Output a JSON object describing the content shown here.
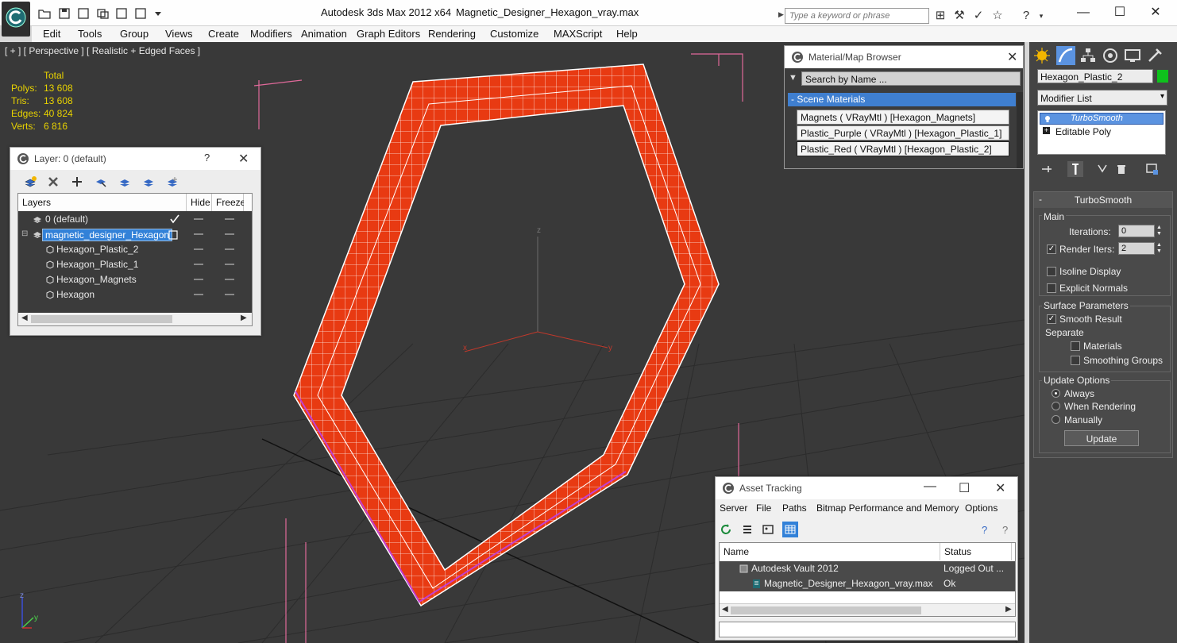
{
  "titlebar": {
    "app_title": "Autodesk 3ds Max  2012 x64",
    "file_title": "Magnetic_Designer_Hexagon_vray.max",
    "search_placeholder": "Type a keyword or phrase",
    "minimize": "—",
    "maximize": "☐",
    "close": "✕"
  },
  "menu": [
    "Edit",
    "Tools",
    "Group",
    "Views",
    "Create",
    "Modifiers",
    "Animation",
    "Graph Editors",
    "Rendering",
    "Customize",
    "MAXScript",
    "Help"
  ],
  "viewport": {
    "label": "[ + ] [ Perspective ] [ Realistic + Edged Faces ]",
    "stats_header": "Total",
    "stats": [
      {
        "label": "Polys:",
        "value": "13 608"
      },
      {
        "label": "Tris:",
        "value": "13 608"
      },
      {
        "label": "Edges:",
        "value": "40 824"
      },
      {
        "label": "Verts:",
        "value": "6 816"
      }
    ],
    "axis_z": "z",
    "axis_x": "x",
    "axis_y": "y"
  },
  "layer_dialog": {
    "title": "Layer: 0 (default)",
    "help": "?",
    "columns": [
      "Layers",
      "Hide",
      "Freeze"
    ],
    "rows": [
      {
        "name": "0 (default)",
        "indent": 0
      },
      {
        "name": "magnetic_designer_Hexagon",
        "indent": 1
      },
      {
        "name": "Hexagon_Plastic_2",
        "indent": 2
      },
      {
        "name": "Hexagon_Plastic_1",
        "indent": 2
      },
      {
        "name": "Hexagon_Magnets",
        "indent": 2
      },
      {
        "name": "Hexagon",
        "indent": 2
      }
    ]
  },
  "material_browser": {
    "title": "Material/Map Browser",
    "search_placeholder": "Search by Name ...",
    "group_header": "- Scene Materials",
    "materials": [
      "Magnets  ( VRayMtl )  [Hexagon_Magnets]",
      "Plastic_Purple  ( VRayMtl )  [Hexagon_Plastic_1]",
      "Plastic_Red  ( VRayMtl )  [Hexagon_Plastic_2]"
    ]
  },
  "command_panel": {
    "object_name": "Hexagon_Plastic_2",
    "object_color": "#0ec21c",
    "modifier_list": "Modifier List",
    "stack": [
      "TurboSmooth",
      "Editable Poly"
    ],
    "rollout_title": "TurboSmooth",
    "main_group": "Main",
    "iterations_label": "Iterations:",
    "iterations_value": "0",
    "render_iters_label": "Render Iters:",
    "render_iters_value": "2",
    "isoline_display": "Isoline Display",
    "explicit_normals": "Explicit Normals",
    "surface_group": "Surface Parameters",
    "smooth_result": "Smooth Result",
    "separate": "Separate",
    "materials": "Materials",
    "smoothing_groups": "Smoothing Groups",
    "update_group": "Update Options",
    "always": "Always",
    "when_rendering": "When Rendering",
    "manually": "Manually",
    "update_button": "Update"
  },
  "asset_tracking": {
    "title": "Asset Tracking",
    "menu": [
      "Server",
      "File",
      "Paths",
      "Bitmap Performance and Memory",
      "Options"
    ],
    "columns": [
      "Name",
      "Status"
    ],
    "rows": [
      {
        "name": "Autodesk Vault 2012",
        "status": "Logged Out ..."
      },
      {
        "name": "Magnetic_Designer_Hexagon_vray.max",
        "status": "Ok"
      }
    ]
  },
  "colors": {
    "hexagon_fill": "#e83a12",
    "selection_blue": "#3281d8",
    "stats_yellow": "#e8d200"
  }
}
